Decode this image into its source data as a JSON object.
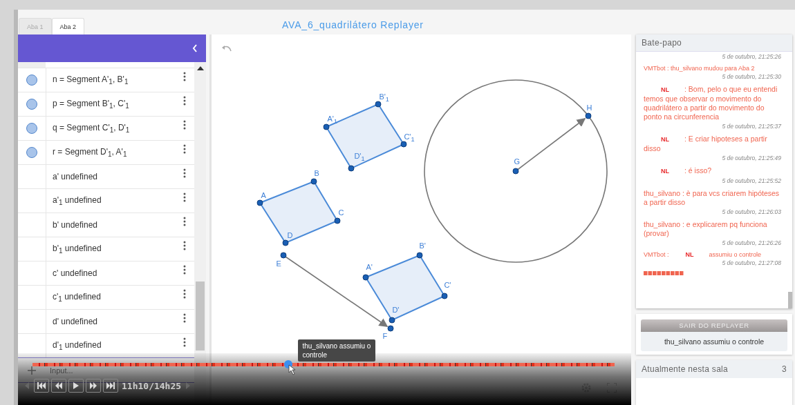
{
  "tabs": [
    {
      "label": "Aba 1",
      "selected": false
    },
    {
      "label": "Aba 2",
      "selected": true
    }
  ],
  "title": "AVA_6_quadrilátero Replayer",
  "algebra": {
    "items": [
      {
        "text": "n = Segment A'$_{1}$, B'$_{1}$",
        "visible": true
      },
      {
        "text": "p = Segment B'$_{1}$, C'$_{1}$",
        "visible": true
      },
      {
        "text": "q = Segment C'$_{1}$, D'$_{1}$",
        "visible": true
      },
      {
        "text": "r = Segment D'$_{1}$, A'$_{1}$",
        "visible": true
      },
      {
        "text": "a' undefined",
        "visible": false
      },
      {
        "text": "a'$_{1}$ undefined",
        "visible": false
      },
      {
        "text": "b' undefined",
        "visible": false
      },
      {
        "text": "b'$_{1}$ undefined",
        "visible": false
      },
      {
        "text": "c' undefined",
        "visible": false
      },
      {
        "text": "c'$_{1}$ undefined",
        "visible": false
      },
      {
        "text": "d' undefined",
        "visible": false
      },
      {
        "text": "d'$_{1}$ undefined",
        "visible": false
      }
    ],
    "input_placeholder": "Input..."
  },
  "canvas": {
    "points": [
      "A'$_{1}$",
      "B'$_{1}$",
      "C'$_{1}$",
      "D'$_{1}$",
      "A",
      "B",
      "C",
      "D",
      "E",
      "F",
      "A'",
      "B'",
      "C'",
      "D'",
      "G",
      "H"
    ]
  },
  "player": {
    "tooltip": "thu_silvano assumiu o controle",
    "time": "11h10/14h25",
    "level": 0.44
  },
  "chat": {
    "title": "Bate-papo",
    "messages": [
      {
        "time": "5 de outubro, 21:25:26"
      },
      {
        "kind": "bot",
        "text": "VMTbot : thu_silvano mudou para Aba 2",
        "time": "5 de outubro, 21:25:30"
      },
      {
        "kind": "user",
        "author": "NL",
        "text": ": Bom, pelo o que eu entendi temos que observar o movimento do quadrilátero a partir do movimento do ponto na circunferencia",
        "time": "5 de outubro, 21:25:37"
      },
      {
        "kind": "user",
        "author": "NL",
        "text": ": E criar hipoteses a partir disso",
        "time": "5 de outubro, 21:25:49"
      },
      {
        "kind": "user",
        "author": "NL",
        "text": ": é isso?",
        "time": "5 de outubro, 21:25:52"
      },
      {
        "kind": "user",
        "text": "thu_silvano : è para vcs criarem hipóteses a partir disso",
        "time": "5 de outubro, 21:26:03"
      },
      {
        "kind": "user",
        "text": "thu_silvano : e explicarem pq funciona (provar)",
        "time": "5 de outubro, 21:26:26"
      },
      {
        "kind": "bot",
        "prefix": "VMTbot :",
        "author": "NL",
        "text": "assumiu o controle",
        "time": "5 de outubro, 21:27:08"
      }
    ]
  },
  "replayer": {
    "button": "SAIR DO REPLAYER",
    "status": "thu_silvano assumiu o controle"
  },
  "room": {
    "title": "Atualmente nesta sala",
    "count": "3"
  }
}
